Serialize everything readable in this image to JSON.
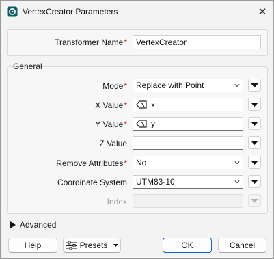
{
  "window": {
    "title": "VertexCreator Parameters",
    "close_label": "✕"
  },
  "transformer": {
    "label": "Transformer Name",
    "value": "VertexCreator"
  },
  "general": {
    "title": "General",
    "mode": {
      "label": "Mode",
      "value": "Replace with Point"
    },
    "x_value": {
      "label": "X Value",
      "value": "x"
    },
    "y_value": {
      "label": "Y Value",
      "value": "y"
    },
    "z_value": {
      "label": "Z Value",
      "value": ""
    },
    "remove_attributes": {
      "label": "Remove Attributes",
      "value": "No"
    },
    "coordinate_system": {
      "label": "Coordinate System",
      "value": "UTM83-10"
    },
    "index": {
      "label": "Index",
      "value": ""
    }
  },
  "advanced": {
    "label": "Advanced"
  },
  "buttons": {
    "help": "Help",
    "presets": "Presets",
    "ok": "OK",
    "cancel": "Cancel"
  },
  "required_marker": "*",
  "colors": {
    "accent": "#0e64c6",
    "required": "#d0201c",
    "app_icon": "#0a5a6a"
  }
}
